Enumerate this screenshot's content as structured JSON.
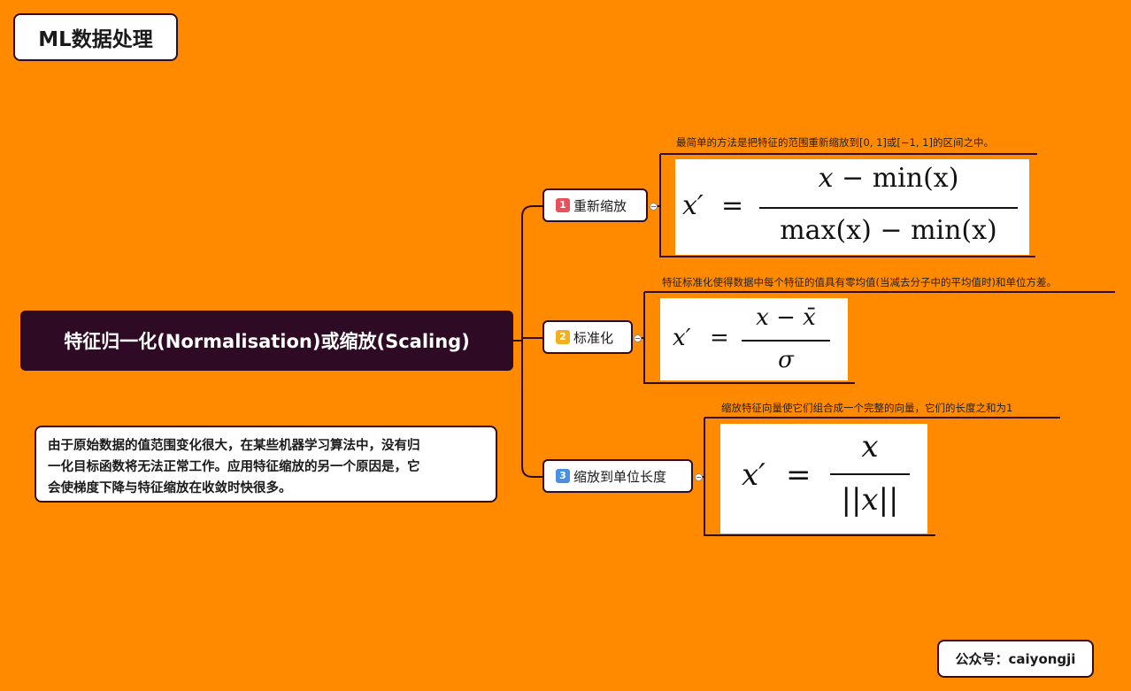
{
  "page_title": "ML数据处理",
  "central_topic": "特征归一化(Normalisation)或缩放(Scaling)",
  "note": {
    "line1": "由于原始数据的值范围变化很大，在某些机器学习算法中，没有归",
    "line2": "一化目标函数将无法正常工作。应用特征缩放的另一个原因是，它",
    "line3": "会使梯度下降与特征缩放在收敛时快很多。"
  },
  "branches": [
    {
      "number": "1",
      "label": "重新缩放",
      "badge_color": "#e8505b",
      "description": "最简单的方法是把特征的范围重新缩放到[0, 1]或[−1, 1]的区间之中。",
      "formula": {
        "lhs": "x′",
        "eq": "=",
        "num_var": "x",
        "num_op": "−",
        "num_func": "min(x)",
        "den_func1": "max(x)",
        "den_op": "−",
        "den_func2": "min(x)"
      }
    },
    {
      "number": "2",
      "label": "标准化",
      "badge_color": "#f2b01e",
      "description": "特征标准化使得数据中每个特征的值具有零均值(当减去分子中的平均值时)和单位方差。",
      "formula": {
        "lhs": "x′",
        "eq": "=",
        "num_var": "x",
        "num_op": "−",
        "num_mean": "x̄",
        "den": "σ"
      }
    },
    {
      "number": "3",
      "label": "缩放到单位长度",
      "badge_color": "#4a90e2",
      "description": "缩放特征向量使它们组合成一个完整的向量，它们的长度之和为1",
      "formula": {
        "lhs": "x′",
        "eq": "=",
        "num": "x",
        "den": "||x||"
      }
    }
  ],
  "footer": "公众号：caiyongji",
  "colors": {
    "background": "#FF8A00",
    "central_bg": "#2e0a24",
    "line": "#2d0d26"
  }
}
